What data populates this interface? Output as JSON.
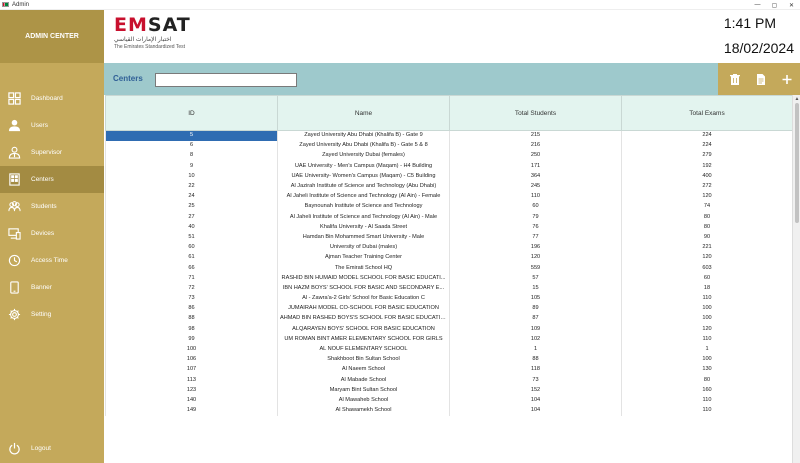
{
  "window": {
    "title": "Admin",
    "minimize": "—",
    "maximize": "▢",
    "close": "✕"
  },
  "sidebar": {
    "title": "ADMIN CENTER",
    "items": [
      {
        "label": "Dashboard",
        "icon": "dashboard-icon"
      },
      {
        "label": "Users",
        "icon": "user-icon"
      },
      {
        "label": "Supervisor",
        "icon": "supervisor-icon"
      },
      {
        "label": "Centers",
        "icon": "building-icon",
        "active": true
      },
      {
        "label": "Students",
        "icon": "students-icon"
      },
      {
        "label": "Devices",
        "icon": "devices-icon"
      },
      {
        "label": "Access Time",
        "icon": "clock-icon"
      },
      {
        "label": "Banner",
        "icon": "tablet-icon"
      },
      {
        "label": "Setting",
        "icon": "gear-icon"
      }
    ],
    "logout": "Logout"
  },
  "header": {
    "logo_word_red": "EM",
    "logo_word": "SAT",
    "logo_arabic": "اختبار الإمارات القياسي",
    "logo_english": "The Emirates Standardized Test",
    "time": "1:41 PM",
    "date": "18/02/2024"
  },
  "toolbar": {
    "title": "Centers",
    "search_value": ""
  },
  "table": {
    "columns": [
      "ID",
      "Name",
      "Total Students",
      "Total Exams"
    ],
    "rows": [
      [
        "5",
        "Zayed University Abu Dhabi (Khalifa B) - Gate 9",
        "215",
        "224"
      ],
      [
        "6",
        "Zayed University Abu Dhabi (Khalifa B) - Gate 5 & 8",
        "216",
        "224"
      ],
      [
        "8",
        "Zayed University Dubai (females)",
        "250",
        "279"
      ],
      [
        "9",
        "UAE University - Men's Campus (Maqam) - H4 Building",
        "171",
        "192"
      ],
      [
        "10",
        "UAE University- Women's Campus (Maqam) - C5 Building",
        "364",
        "400"
      ],
      [
        "22",
        "Al Jazirah Institute of Science and Technology (Abu Dhabi)",
        "245",
        "272"
      ],
      [
        "24",
        "Al Jaheli Institute of Science and Technology (Al Ain) - Female",
        "110",
        "120"
      ],
      [
        "25",
        "Baynounah Institute of Science and Technology",
        "60",
        "74"
      ],
      [
        "27",
        "Al Jaheli Institute of Science and Technology (Al Ain) - Male",
        "79",
        "80"
      ],
      [
        "40",
        "Khalifa University - Al Saada Street",
        "76",
        "80"
      ],
      [
        "51",
        "Hamdan Bin Mohammed Smart University - Male",
        "77",
        "90"
      ],
      [
        "60",
        "University of Dubai (males)",
        "196",
        "221"
      ],
      [
        "61",
        "Ajman Teacher Training Center",
        "120",
        "120"
      ],
      [
        "66",
        "The Emirati School HQ",
        "559",
        "603"
      ],
      [
        "71",
        "RASHID BIN HUMAID MODEL SCHOOL FOR BASIC EDUCATI...",
        "57",
        "60"
      ],
      [
        "72",
        "IBN HAZM BOYS' SCHOOL FOR BASIC AND SECONDARY E...",
        "15",
        "18"
      ],
      [
        "73",
        "Al - Zawra'a-2 Girls' School for Basic Education C",
        "105",
        "110"
      ],
      [
        "86",
        "JUMAIRAH MODEL CO-SCHOOL FOR BASIC EDUCATION",
        "89",
        "100"
      ],
      [
        "88",
        "AHMAD BIN RASHED BOYS'S SCHOOL FOR BASIC EDUCATION",
        "87",
        "100"
      ],
      [
        "98",
        "ALQARAYEN BOYS' SCHOOL FOR BASIC EDUCATION",
        "109",
        "120"
      ],
      [
        "99",
        "UM ROMAN BINT AMER ELEMENTARY SCHOOL FOR GIRLS",
        "102",
        "110"
      ],
      [
        "100",
        "AL NOUF ELEMENTARY SCHOOL",
        "1",
        "1"
      ],
      [
        "106",
        "Shakhboot Bin Sultan School",
        "88",
        "100"
      ],
      [
        "107",
        "Al Naeem School",
        "118",
        "130"
      ],
      [
        "113",
        "Al Mabade School",
        "73",
        "80"
      ],
      [
        "123",
        "Maryam Bint Sultan School",
        "152",
        "160"
      ],
      [
        "140",
        "Al Mawaheb School",
        "104",
        "110"
      ],
      [
        "149",
        "Al Shawamekh School",
        "104",
        "110"
      ]
    ]
  }
}
